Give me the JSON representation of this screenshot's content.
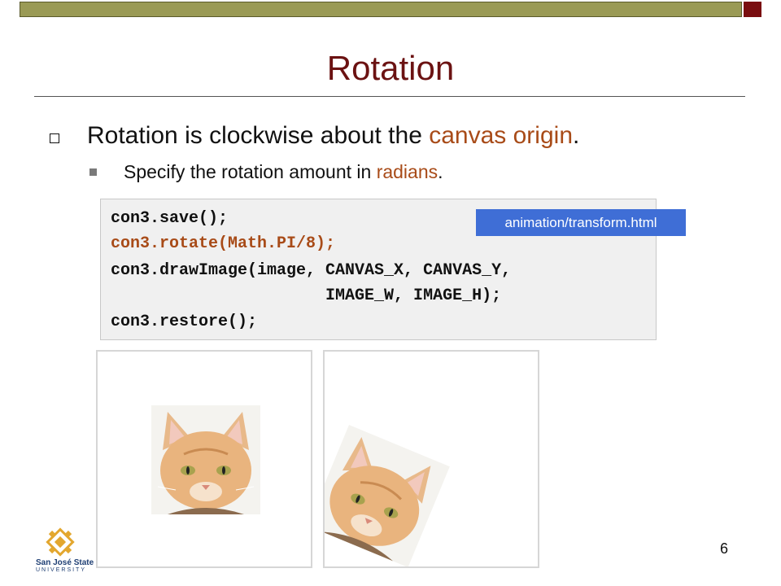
{
  "slide": {
    "title": "Rotation",
    "bullet1": {
      "text_before": "Rotation is clockwise about the ",
      "highlight": "canvas origin",
      "text_after": "."
    },
    "bullet2": {
      "text_before": "Specify the rotation amount in ",
      "highlight": "radians",
      "text_after": "."
    },
    "code_lines": [
      "con3.save();",
      "con3.rotate(Math.PI/8);",
      "con3.drawImage(image, CANVAS_X, CANVAS_Y,",
      "                      IMAGE_W, IMAGE_H);",
      "con3.restore();"
    ],
    "file_tag": "animation/transform.html",
    "page_number": "6",
    "logo": {
      "line1": "San José State",
      "line2": "UNIVERSITY"
    }
  },
  "colors": {
    "title": "#6b1212",
    "accent": "#a84b18",
    "tag_bg": "#3f6ed6",
    "code_bg": "#f0f0f0",
    "top_bar": "#9a9a55",
    "top_bar_end": "#7a0e10"
  },
  "images": {
    "panel_left": "cat-photo",
    "panel_right": "cat-photo-rotated",
    "rotation_shown": "Math.PI/8"
  }
}
